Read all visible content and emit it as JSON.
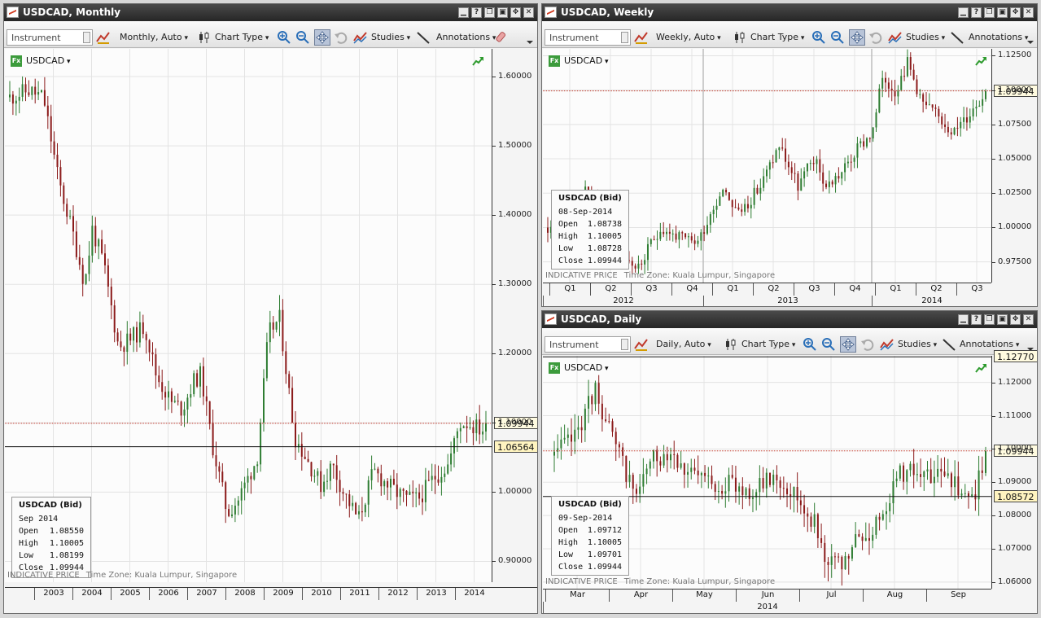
{
  "windows": {
    "monthly": {
      "title": "USDCAD, Monthly",
      "instrument_placeholder": "Instrument",
      "period": "Monthly,",
      "mode": "Auto",
      "chart_type": "Chart Type",
      "studies": "Studies",
      "annotations": "Annotations",
      "legend": "USDCAD",
      "fx": "Fx",
      "info": {
        "heading": "USDCAD (Bid)",
        "date": "Sep 2014",
        "open_k": "Open",
        "open": "1.08550",
        "high_k": "High",
        "high": "1.10005",
        "low_k": "Low",
        "low": "1.08199",
        "close_k": "Close",
        "close": "1.09944"
      },
      "footer_left": "INDICATIVE PRICE",
      "footer_right": "Time Zone: Kuala Lumpur, Singapore",
      "price_tag": "1.09944",
      "line_tag": "1.06564"
    },
    "weekly": {
      "title": "USDCAD, Weekly",
      "instrument_placeholder": "Instrument",
      "period": "Weekly,",
      "mode": "Auto",
      "chart_type": "Chart Type",
      "studies": "Studies",
      "annotations": "Annotations",
      "legend": "USDCAD",
      "fx": "Fx",
      "info": {
        "heading": "USDCAD (Bid)",
        "date": "08-Sep-2014",
        "open_k": "Open",
        "open": "1.08738",
        "high_k": "High",
        "high": "1.10005",
        "low_k": "Low",
        "low": "1.08728",
        "close_k": "Close",
        "close": "1.09944"
      },
      "footer_left": "INDICATIVE PRICE",
      "footer_right": "Time Zone: Kuala Lumpur, Singapore",
      "price_tag": "1.09944"
    },
    "daily": {
      "title": "USDCAD, Daily",
      "instrument_placeholder": "Instrument",
      "period": "Daily,",
      "mode": "Auto",
      "chart_type": "Chart Type",
      "studies": "Studies",
      "annotations": "Annotations",
      "legend": "USDCAD",
      "fx": "Fx",
      "info": {
        "heading": "USDCAD (Bid)",
        "date": "09-Sep-2014",
        "open_k": "Open",
        "open": "1.09712",
        "high_k": "High",
        "high": "1.10005",
        "low_k": "Low",
        "low": "1.09701",
        "close_k": "Close",
        "close": "1.09944"
      },
      "footer_left": "INDICATIVE PRICE",
      "footer_right": "Time Zone: Kuala Lumpur, Singapore",
      "price_tag": "1.09944",
      "line_tag": "1.08572",
      "top_tag": "1.12770"
    }
  },
  "colors": {
    "up": "#2e7d32",
    "down": "#8b1a1a",
    "price_line": "#c0392b",
    "black_line": "#111111"
  },
  "chart_data": [
    {
      "type": "candlestick",
      "title": "USDCAD, Monthly",
      "series": "USDCAD",
      "ylim": [
        0.87,
        1.64
      ],
      "yticks": [
        "1.60000",
        "1.50000",
        "1.40000",
        "1.30000",
        "1.20000",
        "1.10000",
        "1.00000",
        "0.90000"
      ],
      "xticks": [
        "2003",
        "2004",
        "2005",
        "2006",
        "2007",
        "2008",
        "2009",
        "2010",
        "2011",
        "2012",
        "2013",
        "2014"
      ],
      "anchors": [
        [
          2002.0,
          1.57
        ],
        [
          2002.5,
          1.58
        ],
        [
          2002.9,
          1.57
        ],
        [
          2003.3,
          1.45
        ],
        [
          2003.7,
          1.37
        ],
        [
          2004.0,
          1.3
        ],
        [
          2004.2,
          1.38
        ],
        [
          2004.5,
          1.33
        ],
        [
          2004.9,
          1.21
        ],
        [
          2005.2,
          1.22
        ],
        [
          2005.6,
          1.24
        ],
        [
          2005.9,
          1.17
        ],
        [
          2006.3,
          1.13
        ],
        [
          2006.6,
          1.12
        ],
        [
          2006.9,
          1.16
        ],
        [
          2007.1,
          1.17
        ],
        [
          2007.4,
          1.07
        ],
        [
          2007.8,
          0.97
        ],
        [
          2008.1,
          0.99
        ],
        [
          2008.6,
          1.05
        ],
        [
          2008.9,
          1.23
        ],
        [
          2009.2,
          1.25
        ],
        [
          2009.6,
          1.08
        ],
        [
          2009.9,
          1.05
        ],
        [
          2010.3,
          1.01
        ],
        [
          2010.6,
          1.04
        ],
        [
          2010.9,
          1.0
        ],
        [
          2011.3,
          0.96
        ],
        [
          2011.7,
          1.03
        ],
        [
          2011.9,
          1.02
        ],
        [
          2012.3,
          1.0
        ],
        [
          2012.6,
          0.99
        ],
        [
          2012.9,
          0.99
        ],
        [
          2013.3,
          1.02
        ],
        [
          2013.7,
          1.04
        ],
        [
          2014.0,
          1.1
        ],
        [
          2014.2,
          1.1
        ],
        [
          2014.6,
          1.09
        ],
        [
          2014.7,
          1.0994
        ]
      ],
      "price_line": 1.09944,
      "black_line": 1.06564
    },
    {
      "type": "candlestick",
      "title": "USDCAD, Weekly",
      "series": "USDCAD",
      "ylim": [
        0.96,
        1.13
      ],
      "yticks": [
        "1.12500",
        "1.10000",
        "1.07500",
        "1.05000",
        "1.02500",
        "1.00000",
        "0.97500"
      ],
      "xticks": [
        "Q1",
        "Q2",
        "Q3",
        "Q4",
        "Q1",
        "Q2",
        "Q3",
        "Q4",
        "Q1",
        "Q2",
        "Q3"
      ],
      "xyears": [
        "2012",
        "2013",
        "2014"
      ],
      "anchors": [
        [
          0,
          1.0
        ],
        [
          7,
          0.99
        ],
        [
          12,
          1.03
        ],
        [
          17,
          1.01
        ],
        [
          24,
          0.98
        ],
        [
          29,
          0.97
        ],
        [
          36,
          1.0
        ],
        [
          44,
          0.99
        ],
        [
          48,
          0.99
        ],
        [
          56,
          1.03
        ],
        [
          61,
          1.01
        ],
        [
          68,
          1.03
        ],
        [
          74,
          1.06
        ],
        [
          80,
          1.03
        ],
        [
          85,
          1.05
        ],
        [
          89,
          1.03
        ],
        [
          94,
          1.04
        ],
        [
          100,
          1.06
        ],
        [
          104,
          1.07
        ],
        [
          107,
          1.11
        ],
        [
          111,
          1.1
        ],
        [
          115,
          1.12
        ],
        [
          120,
          1.09
        ],
        [
          125,
          1.08
        ],
        [
          130,
          1.07
        ],
        [
          134,
          1.08
        ],
        [
          137,
          1.09
        ],
        [
          140,
          1.0994
        ]
      ],
      "price_line": 1.09944
    },
    {
      "type": "candlestick",
      "title": "USDCAD, Daily",
      "series": "USDCAD",
      "ylim": [
        1.058,
        1.128
      ],
      "yticks": [
        "1.12000",
        "1.11000",
        "1.10000",
        "1.09000",
        "1.08000",
        "1.07000",
        "1.06000"
      ],
      "xticks": [
        "Mar",
        "Apr",
        "May",
        "Jun",
        "Jul",
        "Aug",
        "Sep"
      ],
      "xyears": [
        "2014"
      ],
      "anchors": [
        [
          0,
          1.098
        ],
        [
          6,
          1.104
        ],
        [
          12,
          1.118
        ],
        [
          18,
          1.1
        ],
        [
          24,
          1.086
        ],
        [
          28,
          1.096
        ],
        [
          34,
          1.1
        ],
        [
          40,
          1.092
        ],
        [
          46,
          1.09
        ],
        [
          52,
          1.089
        ],
        [
          58,
          1.087
        ],
        [
          64,
          1.092
        ],
        [
          70,
          1.087
        ],
        [
          76,
          1.078
        ],
        [
          80,
          1.066
        ],
        [
          84,
          1.064
        ],
        [
          88,
          1.072
        ],
        [
          92,
          1.074
        ],
        [
          96,
          1.082
        ],
        [
          101,
          1.093
        ],
        [
          106,
          1.094
        ],
        [
          110,
          1.09
        ],
        [
          115,
          1.094
        ],
        [
          119,
          1.084
        ],
        [
          123,
          1.087
        ],
        [
          126,
          1.0994
        ]
      ],
      "price_line": 1.09944,
      "black_line": 1.08572,
      "top_line": 1.1277
    }
  ]
}
